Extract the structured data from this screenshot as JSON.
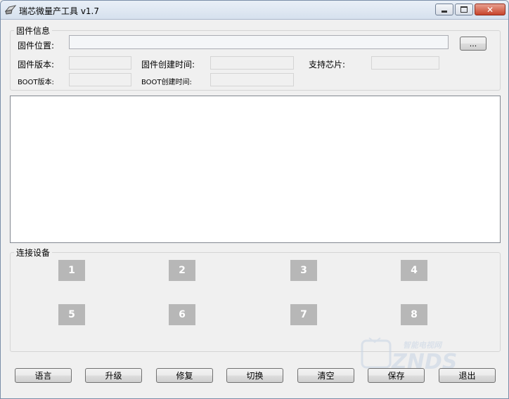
{
  "window": {
    "title": "瑞芯微量产工具 v1.7",
    "close_glyph": "✕"
  },
  "firmware": {
    "group_label": "固件信息",
    "path_label": "固件位置:",
    "path_value": "",
    "browse_label": "...",
    "version_label": "固件版本:",
    "version_value": "",
    "create_time_label": "固件创建时间:",
    "create_time_value": "",
    "chip_label": "支持芯片:",
    "chip_value": "",
    "boot_version_label": "BOOT版本:",
    "boot_version_value": "",
    "boot_time_label": "BOOT创建时间:",
    "boot_time_value": ""
  },
  "log": {
    "content": ""
  },
  "devices": {
    "group_label": "连接设备",
    "slots": [
      "1",
      "2",
      "3",
      "4",
      "5",
      "6",
      "7",
      "8"
    ]
  },
  "buttons": {
    "language": "语言",
    "upgrade": "升级",
    "repair": "修复",
    "switch": "切换",
    "clear": "清空",
    "save": "保存",
    "exit": "退出"
  },
  "watermark": {
    "site_name": "智能电视网",
    "brand": "ZNDS",
    "color": "#c8d4e4"
  }
}
